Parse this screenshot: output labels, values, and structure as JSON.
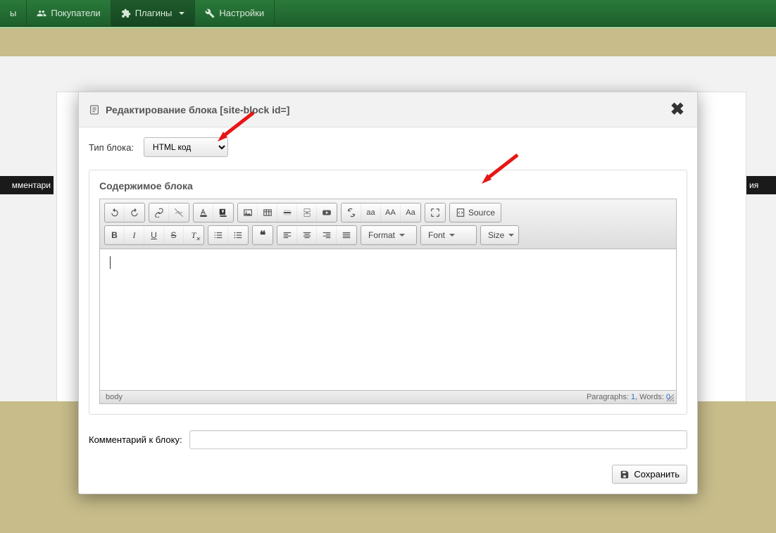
{
  "navbar": {
    "items": [
      {
        "label": "ы"
      },
      {
        "label": "Покупатели"
      },
      {
        "label": "Плагины"
      },
      {
        "label": "Настройки"
      }
    ]
  },
  "bg": {
    "leftbar": "мментари",
    "rightbar": "ия"
  },
  "modal": {
    "title": "Редактирование блока [site-block id=]",
    "type_label": "Тип блока:",
    "type_value": "HTML код",
    "content_label": "Содержимое блока",
    "comment_label": "Комментарий к блоку:",
    "comment_value": "",
    "save_label": "Сохранить"
  },
  "editor": {
    "combos": {
      "format": "Format",
      "font": "Font",
      "size": "Size"
    },
    "source_label": "Source",
    "path": "body",
    "stats_prefix_p": "Paragraphs: ",
    "stats_p": "1",
    "stats_sep": ", Words: ",
    "stats_w": "0",
    "case": {
      "lower": "aa",
      "upper": "AA",
      "title": "Aa"
    }
  }
}
